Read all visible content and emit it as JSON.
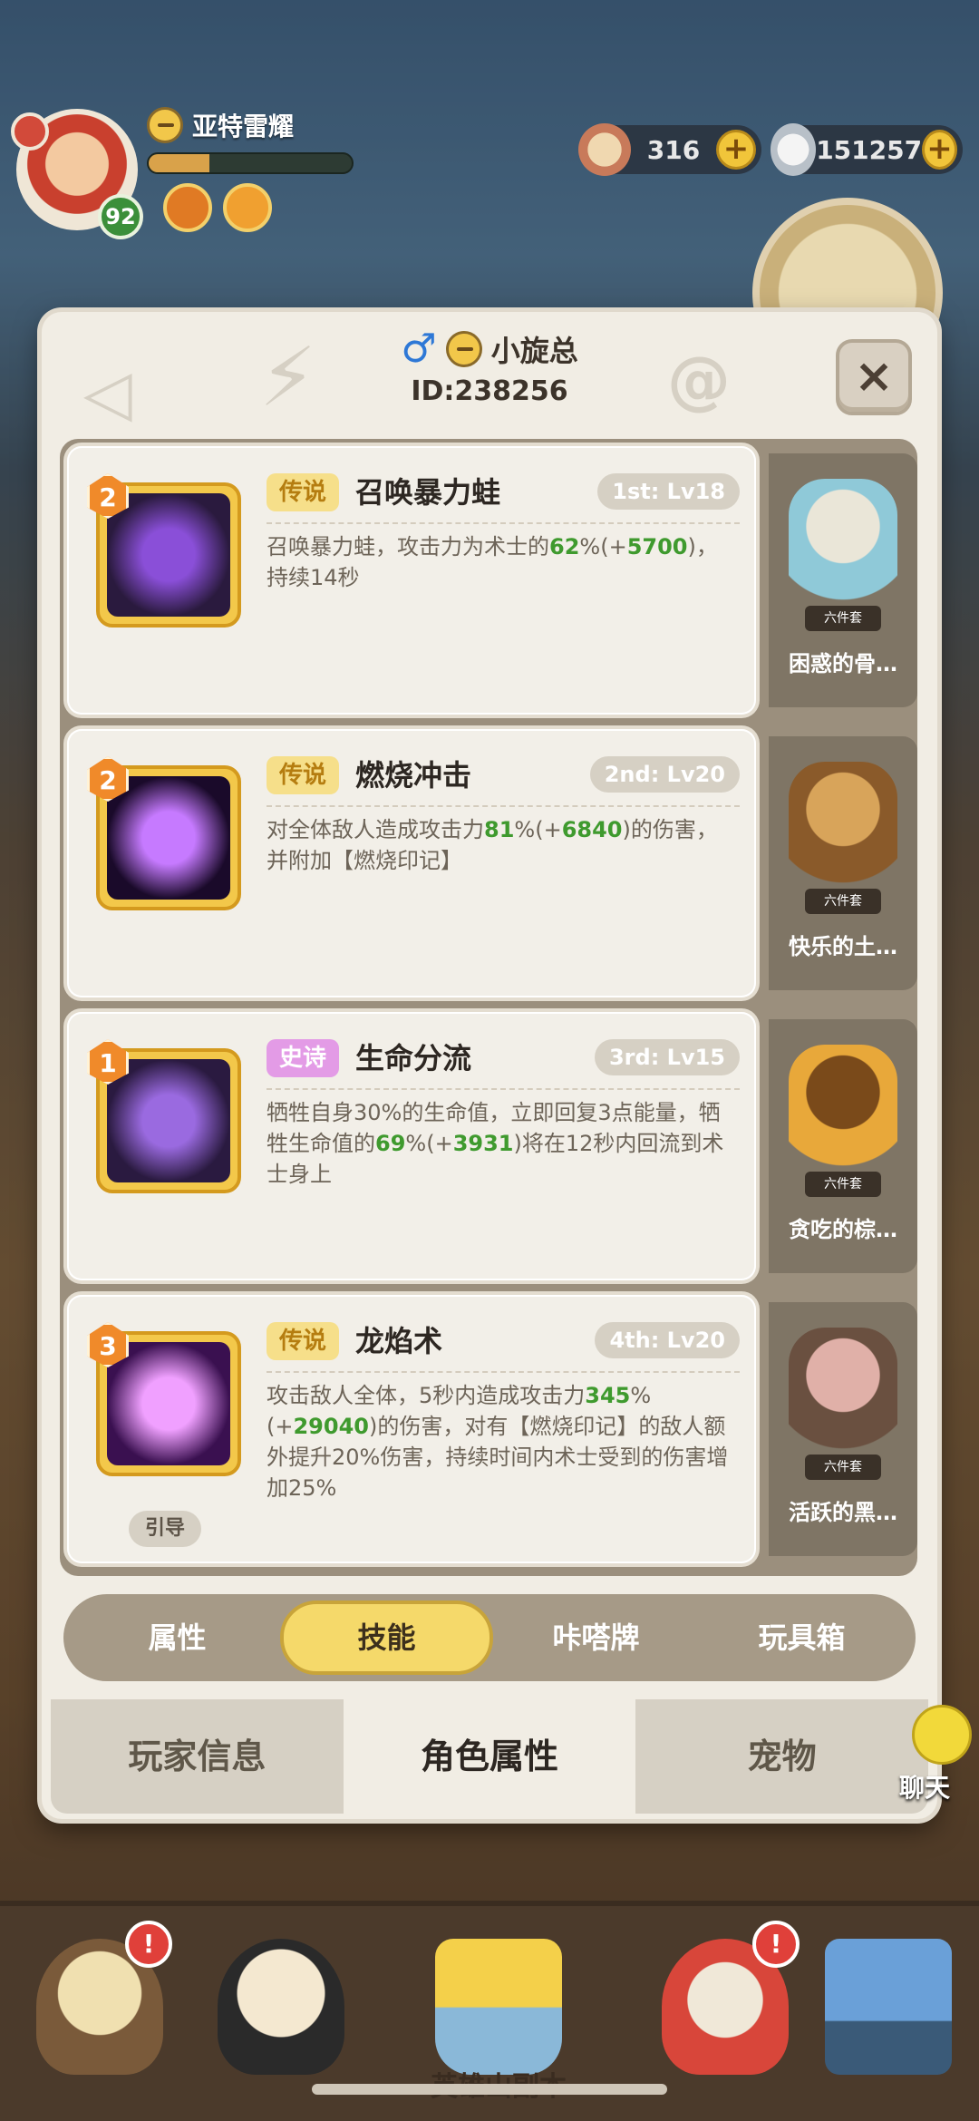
{
  "hud": {
    "player_name": "亚特雷耀",
    "level": "92",
    "exp_fraction": 0.3,
    "currency_1": "316",
    "currency_2": "151257",
    "plus": "+"
  },
  "modal": {
    "name": "小旋总",
    "id": "ID:238256",
    "close": "×",
    "gender": "♂"
  },
  "skills": [
    {
      "count": "2",
      "rarity": "传说",
      "rarity_type": "legend",
      "name": "召唤暴力蛙",
      "level": "1st: Lv18",
      "desc_before": "召唤暴力蛙，攻击力为术士的",
      "g1": "62",
      "mid1": "%(+",
      "g2": "5700",
      "desc_after": ")，持续14秒",
      "tag": "",
      "icon_colors": [
        "#2a1a3e",
        "#8a4fd8"
      ],
      "toy_name": "困惑的骨…",
      "toy_set": "六件套",
      "toy_colors": [
        "#8fc9d8",
        "#eae6d8"
      ]
    },
    {
      "count": "2",
      "rarity": "传说",
      "rarity_type": "legend",
      "name": "燃烧冲击",
      "level": "2nd: Lv20",
      "desc_before": "对全体敌人造成攻击力",
      "g1": "81",
      "mid1": "%(+",
      "g2": "6840",
      "desc_after": ")的伤害，并附加【燃烧印记】",
      "tag": "",
      "icon_colors": [
        "#1a0a2a",
        "#c67aff"
      ],
      "toy_name": "快乐的土…",
      "toy_set": "六件套",
      "toy_colors": [
        "#8a5a2a",
        "#d8a45a"
      ]
    },
    {
      "count": "1",
      "rarity": "史诗",
      "rarity_type": "epic",
      "name": "生命分流",
      "level": "3rd: Lv15",
      "desc_before": "牺牲自身30%的生命值，立即回复3点能量，牺牲生命值的",
      "g1": "69",
      "mid1": "%(+",
      "g2": "3931",
      "desc_after": ")将在12秒内回流到术士身上",
      "tag": "",
      "icon_colors": [
        "#2a1a40",
        "#9a6ae0"
      ],
      "toy_name": "贪吃的棕…",
      "toy_set": "六件套",
      "toy_colors": [
        "#e8a83a",
        "#7a4a1a"
      ]
    },
    {
      "count": "3",
      "rarity": "传说",
      "rarity_type": "legend",
      "name": "龙焰术",
      "level": "4th: Lv20",
      "desc_before": "攻击敌人全体，5秒内造成攻击力",
      "g1": "345",
      "mid1": "%(+",
      "g2": "29040",
      "desc_after": ")的伤害，对有【燃烧印记】的敌人额外提升20%伤害，持续时间内术士受到的伤害增加25%",
      "tag": "引导",
      "icon_colors": [
        "#3a1050",
        "#f0a0ff"
      ],
      "toy_name": "活跃的黑…",
      "toy_set": "六件套",
      "toy_colors": [
        "#6a5040",
        "#e0b0a8"
      ]
    }
  ],
  "sub_tabs": [
    "属性",
    "技能",
    "咔嗒牌",
    "玩具箱"
  ],
  "sub_tab_active": 1,
  "main_tabs": [
    "玩家信息",
    "角色属性",
    "宠物"
  ],
  "main_tab_active": 1,
  "chat": "聊天",
  "bottom_nav": {
    "center_label": "英雄山副本",
    "alert_glyph": "!"
  },
  "colors": {
    "legend_bg": "#f6df8a",
    "epic_bg": "#e39be6",
    "value_green": "#3f9a2e",
    "active_tab": "#f5d96a"
  }
}
